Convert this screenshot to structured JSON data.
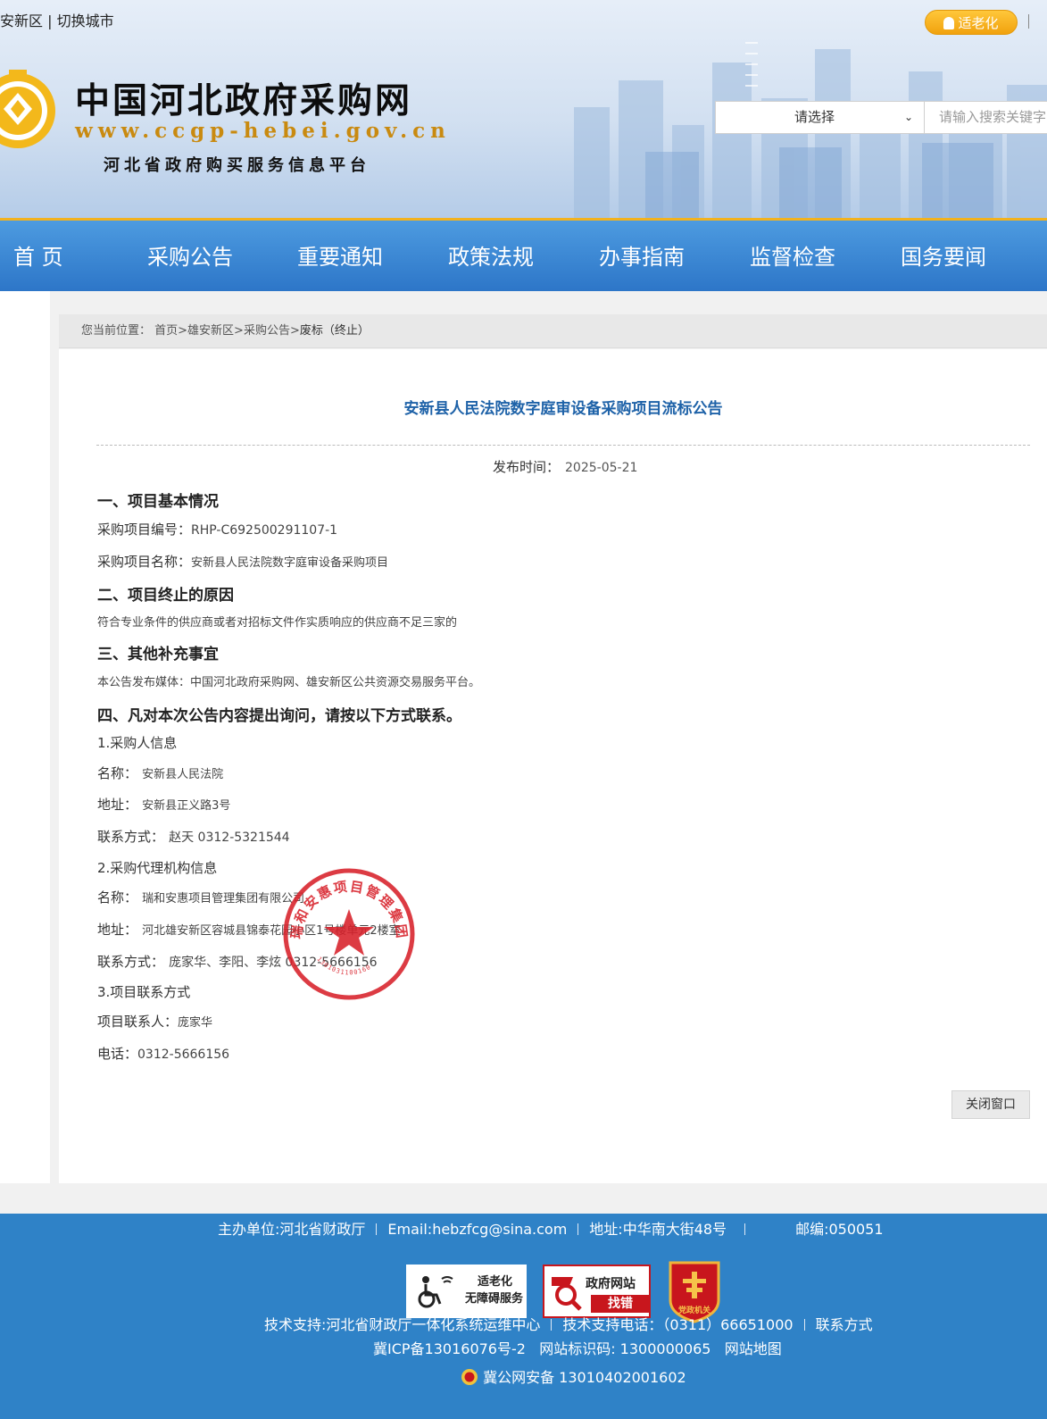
{
  "header": {
    "city_link": "安新区 | 切换城市",
    "elder_mode": "适老化",
    "site_title": "中国河北政府采购网",
    "site_url": "www.ccgp-hebei.gov.cn",
    "site_subtitle": "河北省政府购买服务信息平台",
    "search_select": "请选择",
    "search_placeholder": "请输入搜索关键字"
  },
  "nav": {
    "items": [
      {
        "label": "首 页"
      },
      {
        "label": "采购公告"
      },
      {
        "label": "重要通知"
      },
      {
        "label": "政策法规"
      },
      {
        "label": "办事指南"
      },
      {
        "label": "监督检查"
      },
      {
        "label": "国务要闻"
      }
    ]
  },
  "breadcrumb": {
    "prefix": "您当前位置：",
    "path": "首页>雄安新区>采购公告>",
    "current": "废标（终止）"
  },
  "article": {
    "title": "安新县人民法院数字庭审设备采购项目流标公告",
    "pub_label": "发布时间：",
    "pub_date": "2025-05-21",
    "sec1": "一、项目基本情况",
    "project_no_label": "采购项目编号：",
    "project_no": "RHP-C692500291107-1",
    "project_name_label": "采购项目名称：",
    "project_name": "安新县人民法院数字庭审设备采购项目",
    "sec2": "二、项目终止的原因",
    "reason": "符合专业条件的供应商或者对招标文件作实质响应的供应商不足三家的",
    "sec3": "三、其他补充事宜",
    "media": "本公告发布媒体：中国河北政府采购网、雄安新区公共资源交易服务平台。",
    "sec4": "四、凡对本次公告内容提出询问，请按以下方式联系。",
    "buyer_head": "1.采购人信息",
    "buyer_name_label": "名称：",
    "buyer_name": "安新县人民法院",
    "buyer_addr_label": "地址：",
    "buyer_addr": "安新县正义路3号",
    "buyer_contact_label": "联系方式：",
    "buyer_contact": "赵天 0312-5321544",
    "agency_head": "2.采购代理机构信息",
    "agency_name_label": "名称：",
    "agency_name": "瑞和安惠项目管理集团有限公司",
    "agency_addr_label": "地址：",
    "agency_addr": "河北雄安新区容城县锦泰花园小区1号楼单元2楼室",
    "agency_contact_label": "联系方式：",
    "agency_contact": "庞家华、李阳、李炫 0312-5666156",
    "proj_head": "3.项目联系方式",
    "proj_person_label": "项目联系人：",
    "proj_person": "庞家华",
    "proj_tel_label": "电话：",
    "proj_tel": "0312-5666156",
    "stamp_text": "瑞和安惠项目管理集团有限公司",
    "stamp_code": "1301031100160",
    "close_button": "关闭窗口"
  },
  "footer": {
    "sponsor": "主办单位:河北省财政厅",
    "email": "Email:hebzfcg@sina.com",
    "address": "地址:中华南大街48号",
    "postcode": "邮编:050051",
    "badge_elder_line1": "适老化",
    "badge_elder_line2": "无障碍服务",
    "badge_error_line1": "政府网站",
    "badge_error_line2": "找错",
    "badge_party": "党政机关",
    "tech_support": "技术支持:河北省财政厅一体化系统运维中心",
    "tech_phone": "技术支持电话：（0311）66651000",
    "contact": "联系方式",
    "icp": "冀ICP备13016076号-2",
    "site_id": "网站标识码: 1300000065",
    "sitemap": "网站地图",
    "police": "冀公网安备 13010402001602"
  },
  "colors": {
    "nav_bg": "#3585d3",
    "nav_border": "#f2b21e",
    "title_blue": "#1e62a8",
    "footer_bg": "#2f82c7",
    "stamp_red": "#d8202a"
  }
}
